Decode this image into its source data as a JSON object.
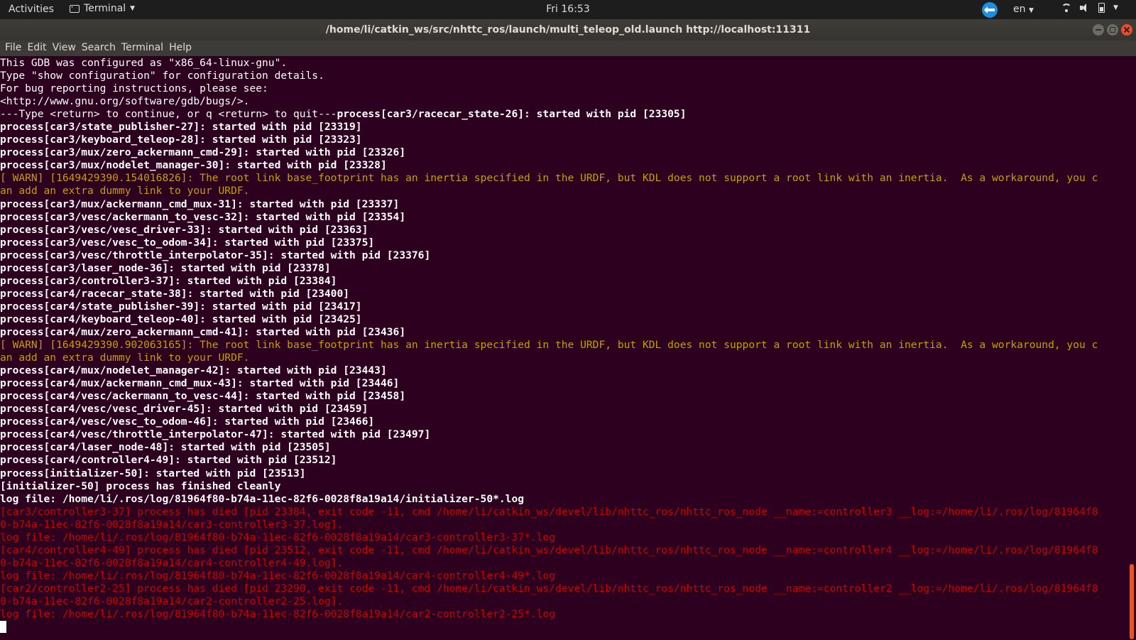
{
  "topbar": {
    "activities": "Activities",
    "app_name": "Terminal",
    "clock": "Fri 16:53",
    "language": "en"
  },
  "window": {
    "title": "/home/li/catkin_ws/src/nhttc_ros/launch/multi_teleop_old.launch http://localhost:11311"
  },
  "menu": [
    "File",
    "Edit",
    "View",
    "Search",
    "Terminal",
    "Help"
  ],
  "colors": {
    "terminal_bg": "#2c001e",
    "warn": "#c4a000",
    "error": "#cc0000",
    "accent": "#e95420"
  },
  "terminal": {
    "lines": [
      {
        "t": "This GDB was configured as \"x86_64-linux-gnu\".",
        "s": "n"
      },
      {
        "t": "Type \"show configuration\" for configuration details.",
        "s": "n"
      },
      {
        "t": "For bug reporting instructions, please see:",
        "s": "n"
      },
      {
        "t": "<http://www.gnu.org/software/gdb/bugs/>.",
        "s": "n"
      },
      {
        "t": "---Type <return> to continue, or q <return> to quit---",
        "s": "n",
        "t2": "process[car3/racecar_state-26]: started with pid [23305]",
        "s2": "b"
      },
      {
        "t": "process[car3/state_publisher-27]: started with pid [23319]",
        "s": "b"
      },
      {
        "t": "process[car3/keyboard_teleop-28]: started with pid [23323]",
        "s": "b"
      },
      {
        "t": "process[car3/mux/zero_ackermann_cmd-29]: started with pid [23326]",
        "s": "b"
      },
      {
        "t": "process[car3/mux/nodelet_manager-30]: started with pid [23328]",
        "s": "b"
      },
      {
        "t": "[ WARN] [1649429390.154016826]: The root link base_footprint has an inertia specified in the URDF, but KDL does not support a root link with an inertia.  As a workaround, you c",
        "s": "w"
      },
      {
        "t": "an add an extra dummy link to your URDF.",
        "s": "w"
      },
      {
        "t": "process[car3/mux/ackermann_cmd_mux-31]: started with pid [23337]",
        "s": "b"
      },
      {
        "t": "process[car3/vesc/ackermann_to_vesc-32]: started with pid [23354]",
        "s": "b"
      },
      {
        "t": "process[car3/vesc/vesc_driver-33]: started with pid [23363]",
        "s": "b"
      },
      {
        "t": "process[car3/vesc/vesc_to_odom-34]: started with pid [23375]",
        "s": "b"
      },
      {
        "t": "process[car3/vesc/throttle_interpolator-35]: started with pid [23376]",
        "s": "b"
      },
      {
        "t": "process[car3/laser_node-36]: started with pid [23378]",
        "s": "b"
      },
      {
        "t": "process[car3/controller3-37]: started with pid [23384]",
        "s": "b"
      },
      {
        "t": "process[car4/racecar_state-38]: started with pid [23400]",
        "s": "b"
      },
      {
        "t": "process[car4/state_publisher-39]: started with pid [23417]",
        "s": "b"
      },
      {
        "t": "process[car4/keyboard_teleop-40]: started with pid [23425]",
        "s": "b"
      },
      {
        "t": "process[car4/mux/zero_ackermann_cmd-41]: started with pid [23436]",
        "s": "b"
      },
      {
        "t": "[ WARN] [1649429390.902063165]: The root link base_footprint has an inertia specified in the URDF, but KDL does not support a root link with an inertia.  As a workaround, you c",
        "s": "w"
      },
      {
        "t": "an add an extra dummy link to your URDF.",
        "s": "w"
      },
      {
        "t": "process[car4/mux/nodelet_manager-42]: started with pid [23443]",
        "s": "b"
      },
      {
        "t": "process[car4/mux/ackermann_cmd_mux-43]: started with pid [23446]",
        "s": "b"
      },
      {
        "t": "process[car4/vesc/ackermann_to_vesc-44]: started with pid [23458]",
        "s": "b"
      },
      {
        "t": "process[car4/vesc/vesc_driver-45]: started with pid [23459]",
        "s": "b"
      },
      {
        "t": "process[car4/vesc/vesc_to_odom-46]: started with pid [23466]",
        "s": "b"
      },
      {
        "t": "process[car4/vesc/throttle_interpolator-47]: started with pid [23497]",
        "s": "b"
      },
      {
        "t": "process[car4/laser_node-48]: started with pid [23505]",
        "s": "b"
      },
      {
        "t": "process[car4/controller4-49]: started with pid [23512]",
        "s": "b"
      },
      {
        "t": "process[initializer-50]: started with pid [23513]",
        "s": "b"
      },
      {
        "t": "[initializer-50] process has finished cleanly",
        "s": "b"
      },
      {
        "t": "log file: /home/li/.ros/log/81964f80-b74a-11ec-82f6-0028f8a19a14/initializer-50*.log",
        "s": "b"
      },
      {
        "t": "[car3/controller3-37] process has died [pid 23384, exit code -11, cmd /home/li/catkin_ws/devel/lib/nhttc_ros/nhttc_ros_node __name:=controller3 __log:=/home/li/.ros/log/81964f8",
        "s": "e"
      },
      {
        "t": "0-b74a-11ec-82f6-0028f8a19a14/car3-controller3-37.log].",
        "s": "e"
      },
      {
        "t": "log file: /home/li/.ros/log/81964f80-b74a-11ec-82f6-0028f8a19a14/car3-controller3-37*.log",
        "s": "e"
      },
      {
        "t": "[car4/controller4-49] process has died [pid 23512, exit code -11, cmd /home/li/catkin_ws/devel/lib/nhttc_ros/nhttc_ros_node __name:=controller4 __log:=/home/li/.ros/log/81964f8",
        "s": "e"
      },
      {
        "t": "0-b74a-11ec-82f6-0028f8a19a14/car4-controller4-49.log].",
        "s": "e"
      },
      {
        "t": "log file: /home/li/.ros/log/81964f80-b74a-11ec-82f6-0028f8a19a14/car4-controller4-49*.log",
        "s": "e"
      },
      {
        "t": "[car2/controller2-25] process has died [pid 23290, exit code -11, cmd /home/li/catkin_ws/devel/lib/nhttc_ros/nhttc_ros_node __name:=controller2 __log:=/home/li/.ros/log/81964f8",
        "s": "e"
      },
      {
        "t": "0-b74a-11ec-82f6-0028f8a19a14/car2-controller2-25.log].",
        "s": "e"
      },
      {
        "t": "log file: /home/li/.ros/log/81964f80-b74a-11ec-82f6-0028f8a19a14/car2-controller2-25*.log",
        "s": "e"
      }
    ]
  }
}
